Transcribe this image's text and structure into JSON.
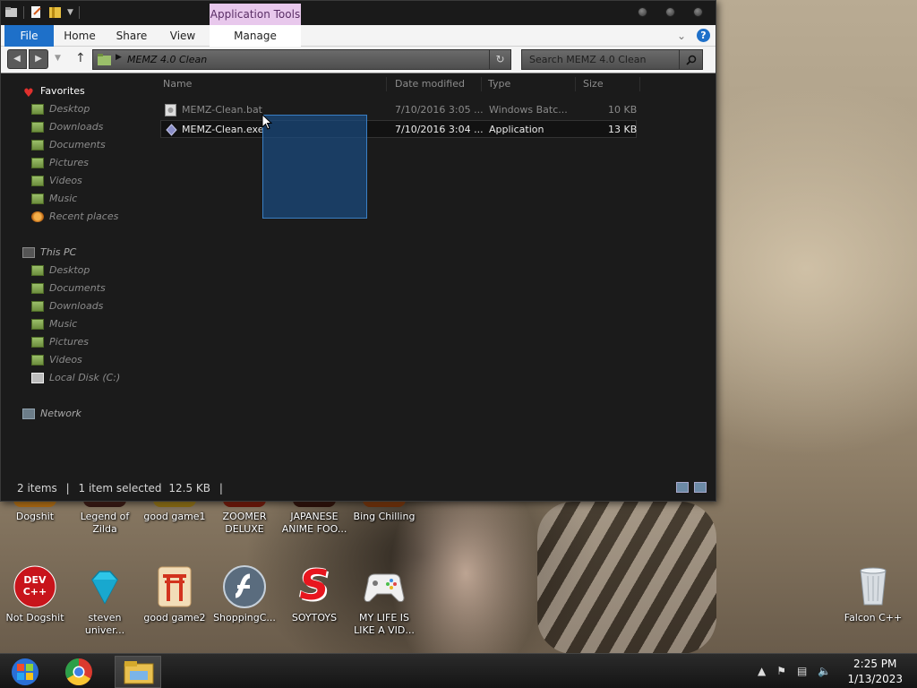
{
  "window": {
    "contextual_tab": "Application Tools",
    "ribbon_tabs": [
      "File",
      "Home",
      "Share",
      "View",
      "Manage"
    ],
    "address": {
      "path": "MEMZ 4.0 Clean"
    },
    "search": {
      "placeholder": "Search MEMZ 4.0 Clean"
    }
  },
  "nav": {
    "favorites": {
      "label": "Favorites",
      "items": [
        "Desktop",
        "Downloads",
        "Documents",
        "Pictures",
        "Videos",
        "Music",
        "Recent places"
      ]
    },
    "this_pc": {
      "label": "This PC",
      "items": [
        "Desktop",
        "Documents",
        "Downloads",
        "Music",
        "Pictures",
        "Videos",
        "Local Disk (C:)"
      ]
    },
    "network": {
      "label": "Network"
    }
  },
  "columns": [
    "Name",
    "Date modified",
    "Type",
    "Size"
  ],
  "files": [
    {
      "name": "MEMZ-Clean.bat",
      "date": "7/10/2016 3:05 ...",
      "type": "Windows Batc...",
      "size": "10 KB",
      "selected": false
    },
    {
      "name": "MEMZ-Clean.exe",
      "date": "7/10/2016 3:04 ...",
      "type": "Application",
      "size": "13 KB",
      "selected": true
    }
  ],
  "status": {
    "count": "2 items",
    "sep1": "|",
    "selection": "1 item selected",
    "size": "12.5 KB",
    "sep2": "|"
  },
  "desktop": {
    "row1": [
      "Dogshit",
      "Legend of Zilda",
      "good game1",
      "ZOOMER DELUXE",
      "JAPANESE ANIME FOO...",
      "Bing Chilling"
    ],
    "row2": [
      "Not Dogshit",
      "steven univer...",
      "good game2",
      "ShoppingC...",
      "SOYTOYS",
      "MY LIFE IS LIKE A VID..."
    ],
    "recycle": "Falcon C++",
    "devcpp_text": "DEV C++",
    "soytoys_letter": "S"
  },
  "taskbar": {
    "time": "2:25 PM",
    "date": "1/13/2023"
  }
}
